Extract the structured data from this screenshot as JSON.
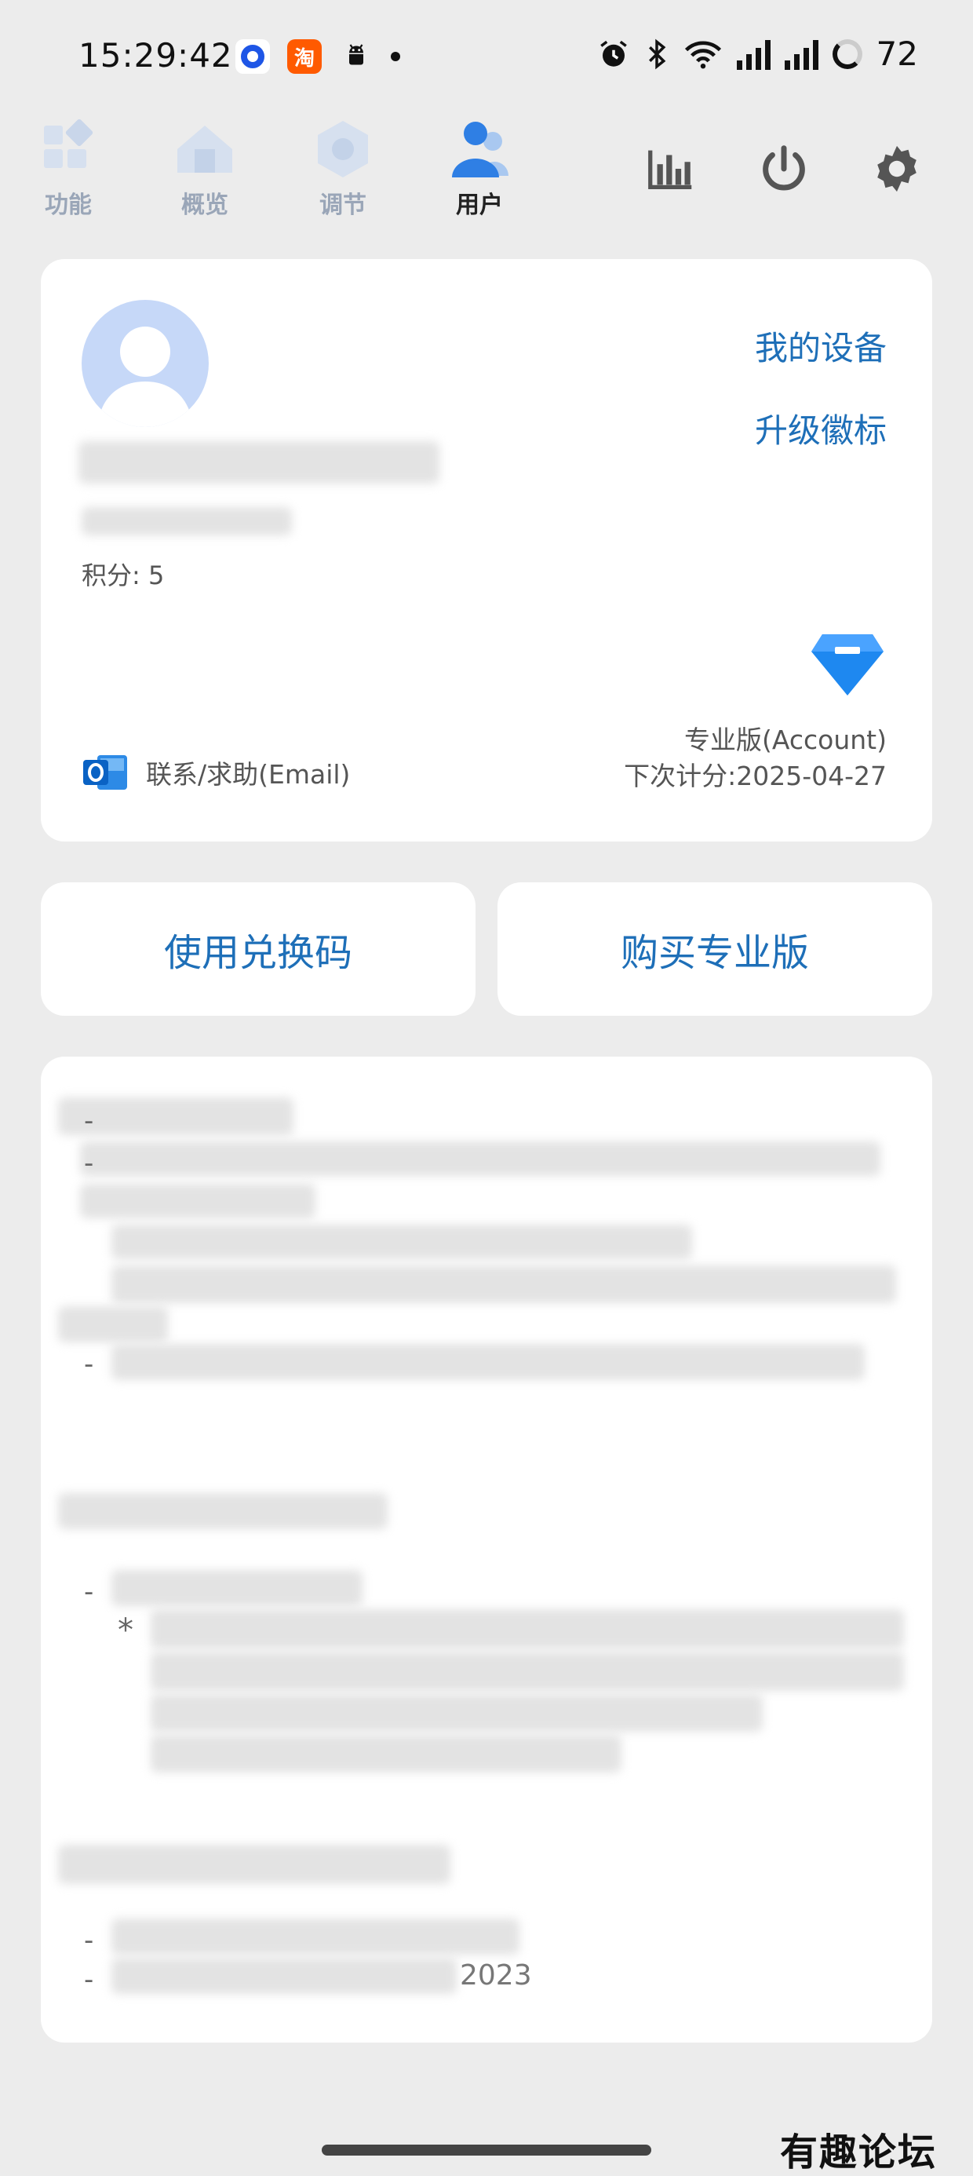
{
  "status_bar": {
    "time": "15:29:42",
    "apps": [
      "app-circle-icon",
      "taobao-icon",
      "android-icon",
      "dot"
    ],
    "taobao_glyph": "淘",
    "battery": "72",
    "right_icons": [
      "alarm-icon",
      "bluetooth-icon",
      "wifi-icon",
      "signal-icon",
      "signal-icon",
      "battery-icon"
    ]
  },
  "tabs": [
    {
      "label": "功能",
      "active": false
    },
    {
      "label": "概览",
      "active": false
    },
    {
      "label": "调节",
      "active": false
    },
    {
      "label": "用户",
      "active": true
    }
  ],
  "toolbar": [
    "chart-icon",
    "power-icon",
    "gear-icon"
  ],
  "profile": {
    "points_label": "积分:",
    "points_value": "5",
    "links": [
      "我的设备",
      "升级徽标"
    ],
    "plan": "专业版(Account)",
    "next_count": "下次计分:2025-04-27",
    "contact": "联系/求助(Email)"
  },
  "buttons": {
    "redeem": "使用兑换码",
    "buy": "购买专业版"
  },
  "notes": {
    "dash": "-",
    "star": "*",
    "year": "2023"
  },
  "watermark": "有趣论坛",
  "colors": {
    "accent": "#1e6fb8",
    "tab_active": "#2f7fe4",
    "tab_inactive": "#c9d6ea",
    "background": "#ececec",
    "card": "#ffffff"
  }
}
